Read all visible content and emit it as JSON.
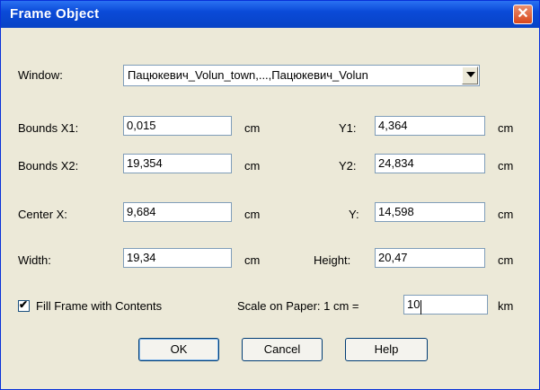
{
  "dialog": {
    "title": "Frame Object",
    "close_icon": "close-icon",
    "window_label": "Window:",
    "window_value": "Пацюкевич_Volun_town,...,Пацюкевич_Volun",
    "fields": {
      "bx1_label": "Bounds X1:",
      "bx1_value": "0,015",
      "y1_label": "Y1:",
      "y1_value": "4,364",
      "bx2_label": "Bounds X2:",
      "bx2_value": "19,354",
      "y2_label": "Y2:",
      "y2_value": "24,834",
      "cx_label": "Center X:",
      "cx_value": "9,684",
      "cy_label": "Y:",
      "cy_value": "14,598",
      "width_label": "Width:",
      "width_value": "19,34",
      "height_label": "Height:",
      "height_value": "20,47"
    },
    "unit": "cm",
    "fill_frame_label": "Fill Frame with Contents",
    "fill_frame_checked": true,
    "scale_label": "Scale on Paper: 1 cm =",
    "scale_value": "10",
    "scale_unit": "km",
    "buttons": {
      "ok": "OK",
      "cancel": "Cancel",
      "help": "Help"
    }
  }
}
